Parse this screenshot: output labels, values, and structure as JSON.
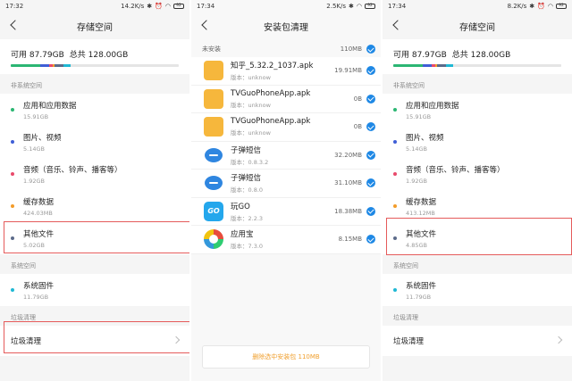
{
  "panel1": {
    "status": {
      "time": "17:32",
      "net": "14.2K/s",
      "battery": "92"
    },
    "title": "存储空间",
    "storage": {
      "available": "可用 87.79GB",
      "total": "总共 128.00GB"
    },
    "non_system_label": "非系统空间",
    "items": [
      {
        "title": "应用和应用数据",
        "sub": "15.91GB",
        "color": "#2bb673"
      },
      {
        "title": "图片、视频",
        "sub": "5.14GB",
        "color": "#3f5ed6"
      },
      {
        "title": "音频（音乐、铃声、播客等）",
        "sub": "1.92GB",
        "color": "#e84a6b"
      },
      {
        "title": "缓存数据",
        "sub": "424.03MB",
        "color": "#f39c29"
      },
      {
        "title": "其他文件",
        "sub": "5.02GB",
        "color": "#5c6b8a"
      }
    ],
    "system_label": "系统空间",
    "system_item": {
      "title": "系统固件",
      "sub": "11.79GB",
      "color": "#1fb8d4"
    },
    "trash_label": "垃圾清理",
    "trash_item": "垃圾清理"
  },
  "panel2": {
    "status": {
      "time": "17:34",
      "net": "2.5K/s",
      "battery": "92"
    },
    "title": "安装包清理",
    "section": {
      "label": "未安装",
      "size": "110MB"
    },
    "packages": [
      {
        "name": "知乎_5.32.2_1037.apk",
        "ver": "版本：unknow",
        "size": "19.91MB",
        "icon": "folder"
      },
      {
        "name": "TVGuoPhoneApp.apk",
        "ver": "版本：unknow",
        "size": "0B",
        "icon": "folder"
      },
      {
        "name": "TVGuoPhoneApp.apk",
        "ver": "版本：unknow",
        "size": "0B",
        "icon": "folder"
      },
      {
        "name": "子弹短信",
        "ver": "版本：0.8.3.2",
        "size": "32.20MB",
        "icon": "sms"
      },
      {
        "name": "子弹短信",
        "ver": "版本：0.8.0",
        "size": "31.10MB",
        "icon": "sms"
      },
      {
        "name": "玩GO",
        "ver": "版本：2.2.3",
        "size": "18.38MB",
        "icon": "go",
        "icon_text": "GO"
      },
      {
        "name": "应用宝",
        "ver": "版本：7.3.0",
        "size": "8.15MB",
        "icon": "yyb"
      }
    ],
    "footer": "删除选中安装包 110MB"
  },
  "panel3": {
    "status": {
      "time": "17:34",
      "net": "8.2K/s",
      "battery": "92"
    },
    "title": "存储空间",
    "storage": {
      "available": "可用 87.97GB",
      "total": "总共 128.00GB"
    },
    "non_system_label": "非系统空间",
    "items": [
      {
        "title": "应用和应用数据",
        "sub": "15.91GB",
        "color": "#2bb673"
      },
      {
        "title": "图片、视频",
        "sub": "5.14GB",
        "color": "#3f5ed6"
      },
      {
        "title": "音频（音乐、铃声、播客等）",
        "sub": "1.92GB",
        "color": "#e84a6b"
      },
      {
        "title": "缓存数据",
        "sub": "413.12MB",
        "color": "#f39c29"
      },
      {
        "title": "其他文件",
        "sub": "4.85GB",
        "color": "#5c6b8a"
      }
    ],
    "system_label": "系统空间",
    "system_item": {
      "title": "系统固件",
      "sub": "11.79GB",
      "color": "#1fb8d4"
    },
    "trash_label": "垃圾清理",
    "trash_item": "垃圾清理"
  },
  "colors": {
    "accent": "#1e88e5",
    "highlight": "#e55b5b",
    "delete_text": "#f0a030"
  }
}
